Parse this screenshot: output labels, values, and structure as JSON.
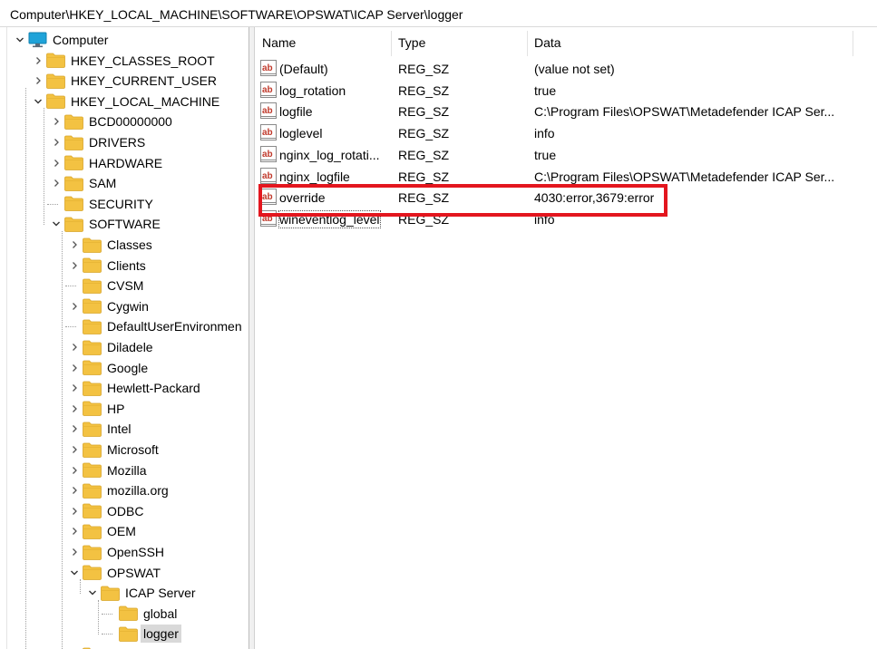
{
  "address": "Computer\\HKEY_LOCAL_MACHINE\\SOFTWARE\\OPSWAT\\ICAP Server\\logger",
  "tree": [
    {
      "label": "Computer",
      "level": 0,
      "expander": "expanded",
      "icon": "computer-icon"
    },
    {
      "label": "HKEY_CLASSES_ROOT",
      "level": 1,
      "expander": "collapsed",
      "icon": "folder-icon"
    },
    {
      "label": "HKEY_CURRENT_USER",
      "level": 1,
      "expander": "collapsed",
      "icon": "folder-icon"
    },
    {
      "label": "HKEY_LOCAL_MACHINE",
      "level": 1,
      "expander": "expanded",
      "icon": "folder-icon"
    },
    {
      "label": "BCD00000000",
      "level": 2,
      "expander": "collapsed",
      "icon": "folder-icon"
    },
    {
      "label": "DRIVERS",
      "level": 2,
      "expander": "collapsed",
      "icon": "folder-icon"
    },
    {
      "label": "HARDWARE",
      "level": 2,
      "expander": "collapsed",
      "icon": "folder-icon"
    },
    {
      "label": "SAM",
      "level": 2,
      "expander": "collapsed",
      "icon": "folder-icon"
    },
    {
      "label": "SECURITY",
      "level": 2,
      "expander": "none",
      "icon": "folder-icon"
    },
    {
      "label": "SOFTWARE",
      "level": 2,
      "expander": "expanded",
      "icon": "folder-icon"
    },
    {
      "label": "Classes",
      "level": 3,
      "expander": "collapsed",
      "icon": "folder-icon"
    },
    {
      "label": "Clients",
      "level": 3,
      "expander": "collapsed",
      "icon": "folder-icon"
    },
    {
      "label": "CVSM",
      "level": 3,
      "expander": "none",
      "icon": "folder-icon"
    },
    {
      "label": "Cygwin",
      "level": 3,
      "expander": "collapsed",
      "icon": "folder-icon"
    },
    {
      "label": "DefaultUserEnvironmen",
      "level": 3,
      "expander": "none",
      "icon": "folder-icon"
    },
    {
      "label": "Diladele",
      "level": 3,
      "expander": "collapsed",
      "icon": "folder-icon"
    },
    {
      "label": "Google",
      "level": 3,
      "expander": "collapsed",
      "icon": "folder-icon"
    },
    {
      "label": "Hewlett-Packard",
      "level": 3,
      "expander": "collapsed",
      "icon": "folder-icon"
    },
    {
      "label": "HP",
      "level": 3,
      "expander": "collapsed",
      "icon": "folder-icon"
    },
    {
      "label": "Intel",
      "level": 3,
      "expander": "collapsed",
      "icon": "folder-icon"
    },
    {
      "label": "Microsoft",
      "level": 3,
      "expander": "collapsed",
      "icon": "folder-icon"
    },
    {
      "label": "Mozilla",
      "level": 3,
      "expander": "collapsed",
      "icon": "folder-icon"
    },
    {
      "label": "mozilla.org",
      "level": 3,
      "expander": "collapsed",
      "icon": "folder-icon"
    },
    {
      "label": "ODBC",
      "level": 3,
      "expander": "collapsed",
      "icon": "folder-icon"
    },
    {
      "label": "OEM",
      "level": 3,
      "expander": "collapsed",
      "icon": "folder-icon"
    },
    {
      "label": "OpenSSH",
      "level": 3,
      "expander": "collapsed",
      "icon": "folder-icon"
    },
    {
      "label": "OPSWAT",
      "level": 3,
      "expander": "expanded",
      "icon": "folder-icon"
    },
    {
      "label": "ICAP Server",
      "level": 4,
      "expander": "expanded",
      "icon": "folder-icon"
    },
    {
      "label": "global",
      "level": 5,
      "expander": "none",
      "icon": "folder-icon"
    },
    {
      "label": "logger",
      "level": 5,
      "expander": "none",
      "icon": "folder-icon",
      "selected": true
    },
    {
      "label": "",
      "level": 3,
      "expander": "collapsed",
      "icon": "folder-icon"
    }
  ],
  "columns": {
    "name": "Name",
    "type": "Type",
    "data": "Data"
  },
  "values": [
    {
      "name": "(Default)",
      "type": "REG_SZ",
      "data": "(value not set)"
    },
    {
      "name": "log_rotation",
      "type": "REG_SZ",
      "data": "true"
    },
    {
      "name": "logfile",
      "type": "REG_SZ",
      "data": "C:\\Program Files\\OPSWAT\\Metadefender ICAP Ser..."
    },
    {
      "name": "loglevel",
      "type": "REG_SZ",
      "data": "info"
    },
    {
      "name": "nginx_log_rotati...",
      "type": "REG_SZ",
      "data": "true"
    },
    {
      "name": "nginx_logfile",
      "type": "REG_SZ",
      "data": "C:\\Program Files\\OPSWAT\\Metadefender ICAP Ser..."
    },
    {
      "name": "override",
      "type": "REG_SZ",
      "data": "4030:error,3679:error",
      "highlighted": true
    },
    {
      "name": "wineventlog_level",
      "type": "REG_SZ",
      "data": "info",
      "focused": true
    }
  ],
  "colors": {
    "highlight": "#e3161e",
    "folder": "#f3c242",
    "computer": "#1fa3d9",
    "selection": "#d9d9d9"
  }
}
